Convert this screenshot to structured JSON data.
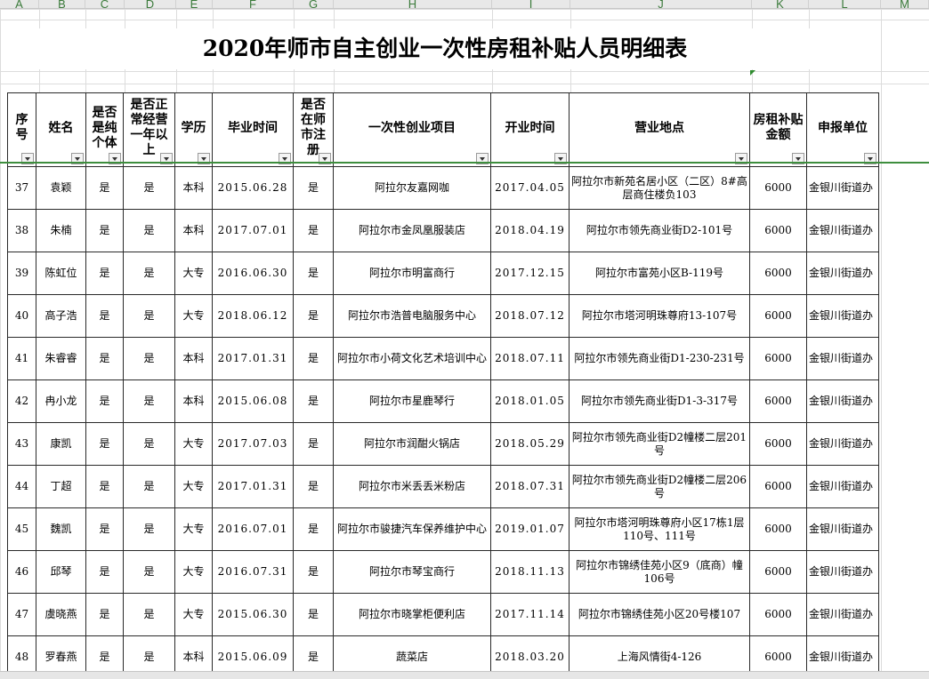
{
  "column_letters": [
    "A",
    "B",
    "C",
    "D",
    "E",
    "F",
    "G",
    "H",
    "I",
    "J",
    "K",
    "L",
    "M"
  ],
  "title": "2020年师市自主创业一次性房租补贴人员明细表",
  "headers": {
    "seq": "序号",
    "name": "姓名",
    "pure_individual": "是否是纯个体",
    "normal_operation": "是否正常经营一年以上",
    "education": "学历",
    "graduation": "毕业时间",
    "registered": "是否在师市注册",
    "project": "一次性创业项目",
    "open_date": "开业时间",
    "location": "营业地点",
    "subsidy": "房租补贴金额",
    "unit": "申报单位"
  },
  "rows": [
    {
      "seq": "37",
      "name": "袁颖",
      "pure": "是",
      "normal": "是",
      "edu": "本科",
      "grad": "2015.06.28",
      "reg": "是",
      "project": "阿拉尔友嘉网咖",
      "open": "2017.04.05",
      "location": "阿拉尔市新苑名居小区（二区）8#高层商住楼负103",
      "amount": "6000",
      "unit": "金银川街道办"
    },
    {
      "seq": "38",
      "name": "朱楠",
      "pure": "是",
      "normal": "是",
      "edu": "本科",
      "grad": "2017.07.01",
      "reg": "是",
      "project": "阿拉尔市金凤凰服装店",
      "open": "2018.04.19",
      "location": "阿拉尔市领先商业街D2-101号",
      "amount": "6000",
      "unit": "金银川街道办"
    },
    {
      "seq": "39",
      "name": "陈虹位",
      "pure": "是",
      "normal": "是",
      "edu": "大专",
      "grad": "2016.06.30",
      "reg": "是",
      "project": "阿拉尔市明富商行",
      "open": "2017.12.15",
      "location": "阿拉尔市富苑小区B-119号",
      "amount": "6000",
      "unit": "金银川街道办"
    },
    {
      "seq": "40",
      "name": "高子浩",
      "pure": "是",
      "normal": "是",
      "edu": "大专",
      "grad": "2018.06.12",
      "reg": "是",
      "project": "阿拉尔市浩普电脑服务中心",
      "open": "2018.07.12",
      "location": "阿拉尔市塔河明珠尊府13-107号",
      "amount": "6000",
      "unit": "金银川街道办"
    },
    {
      "seq": "41",
      "name": "朱睿睿",
      "pure": "是",
      "normal": "是",
      "edu": "本科",
      "grad": "2017.01.31",
      "reg": "是",
      "project": "阿拉尔市小荷文化艺术培训中心",
      "open": "2018.07.11",
      "location": "阿拉尔市领先商业街D1-230-231号",
      "amount": "6000",
      "unit": "金银川街道办"
    },
    {
      "seq": "42",
      "name": "冉小龙",
      "pure": "是",
      "normal": "是",
      "edu": "本科",
      "grad": "2015.06.08",
      "reg": "是",
      "project": "阿拉尔市星鹿琴行",
      "open": "2018.01.05",
      "location": "阿拉尔市领先商业街D1-3-317号",
      "amount": "6000",
      "unit": "金银川街道办"
    },
    {
      "seq": "43",
      "name": "康凯",
      "pure": "是",
      "normal": "是",
      "edu": "大专",
      "grad": "2017.07.03",
      "reg": "是",
      "project": "阿拉尔市润酣火锅店",
      "open": "2018.05.29",
      "location": "阿拉尔市领先商业街D2幢楼二层201号",
      "amount": "6000",
      "unit": "金银川街道办"
    },
    {
      "seq": "44",
      "name": "丁超",
      "pure": "是",
      "normal": "是",
      "edu": "大专",
      "grad": "2017.01.31",
      "reg": "是",
      "project": "阿拉尔市米丢丢米粉店",
      "open": "2018.07.31",
      "location": "阿拉尔市领先商业街D2幢楼二层206号",
      "amount": "6000",
      "unit": "金银川街道办"
    },
    {
      "seq": "45",
      "name": "魏凯",
      "pure": "是",
      "normal": "是",
      "edu": "大专",
      "grad": "2016.07.01",
      "reg": "是",
      "project": "阿拉尔市骏捷汽车保养维护中心",
      "open": "2019.01.07",
      "location": "阿拉尔市塔河明珠尊府小区17栋1层110号、111号",
      "amount": "6000",
      "unit": "金银川街道办"
    },
    {
      "seq": "46",
      "name": "邱琴",
      "pure": "是",
      "normal": "是",
      "edu": "大专",
      "grad": "2016.07.31",
      "reg": "是",
      "project": "阿拉尔市琴宝商行",
      "open": "2018.11.13",
      "location": "阿拉尔市锦绣佳苑小区9（底商）幢106号",
      "amount": "6000",
      "unit": "金银川街道办"
    },
    {
      "seq": "47",
      "name": "虞晓燕",
      "pure": "是",
      "normal": "是",
      "edu": "大专",
      "grad": "2015.06.30",
      "reg": "是",
      "project": "阿拉尔市晓掌柜便利店",
      "open": "2017.11.14",
      "location": "阿拉尔市锦绣佳苑小区20号楼107",
      "amount": "6000",
      "unit": "金银川街道办"
    },
    {
      "seq": "48",
      "name": "罗春燕",
      "pure": "是",
      "normal": "是",
      "edu": "本科",
      "grad": "2015.06.09",
      "reg": "是",
      "project": "蔬菜店",
      "open": "2018.03.20",
      "location": "上海风情街4-126",
      "amount": "6000",
      "unit": "金银川街道办"
    }
  ]
}
